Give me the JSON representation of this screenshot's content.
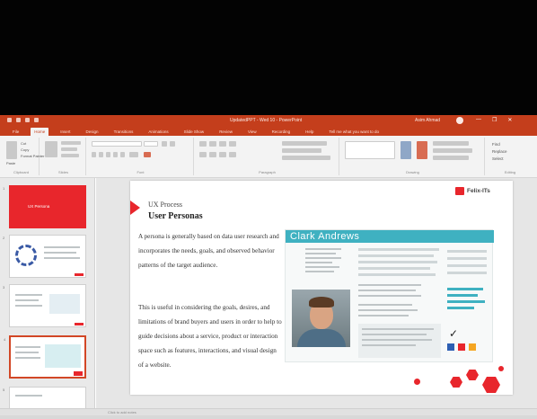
{
  "window": {
    "title": "UpdatedPPT - Wed 10 - PowerPoint",
    "user": "Asim Ahmad",
    "controls": [
      "—",
      "❐",
      "✕"
    ]
  },
  "tabs": [
    "File",
    "Home",
    "Insert",
    "Design",
    "Transitions",
    "Animations",
    "Slide Show",
    "Review",
    "View",
    "Recording",
    "Help",
    "Tell me what you want to do"
  ],
  "ribbon": {
    "groups": [
      "Clipboard",
      "Slides",
      "Font",
      "Paragraph",
      "Drawing",
      "Editing"
    ],
    "clipboard": {
      "paste": "Paste",
      "cut": "Cut",
      "copy": "Copy",
      "format_painter": "Format Painter"
    },
    "editing": {
      "find": "Find",
      "replace": "Replace",
      "select": "Select"
    }
  },
  "thumbnails": {
    "first_slide_text": "UX Persona",
    "numbers": [
      "1",
      "2",
      "3",
      "4",
      "5"
    ]
  },
  "slide": {
    "breadcrumb": "UX Process",
    "title": "User Personas",
    "paragraph1": "A persona is generally based on data user research and incorporates the needs, goals, and observed behavior patterns of the target audience.",
    "paragraph2": "This is useful in considering the goals, desires, and limitations of brand buyers and users in order to help to guide decisions about a service, product or interaction space such as features, interactions, and visual design of a website.",
    "logo_text": "Felix-ITs",
    "persona_name": "Clark Andrews"
  },
  "status": {
    "notes_hint": "Click to add notes"
  },
  "colors": {
    "accent": "#c43e1c",
    "brand_red": "#e8262c",
    "persona_teal": "#3fb1c1"
  }
}
